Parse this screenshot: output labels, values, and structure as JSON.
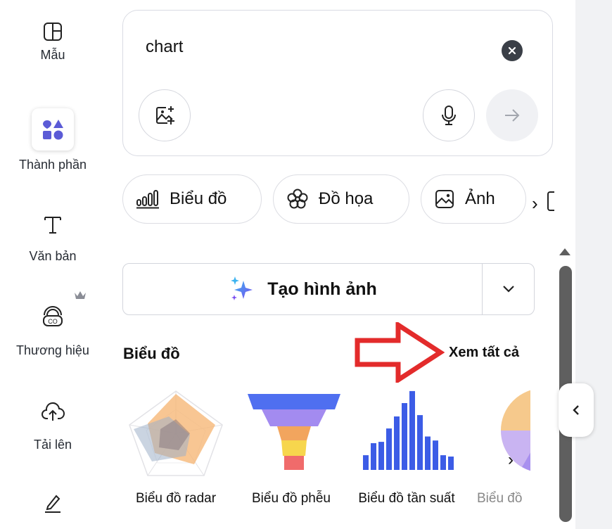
{
  "nav": {
    "items": [
      {
        "label": "Mẫu",
        "icon": "template-icon"
      },
      {
        "label": "Thành phần",
        "icon": "elements-icon",
        "active": true
      },
      {
        "label": "Văn bản",
        "icon": "text-icon"
      },
      {
        "label": "Thương hiệu",
        "icon": "brand-icon",
        "badge": "crown-icon"
      },
      {
        "label": "Tải lên",
        "icon": "upload-cloud-icon"
      },
      {
        "label": "",
        "icon": "draw-icon"
      }
    ]
  },
  "search": {
    "query": "chart",
    "buttons": [
      "image-upload-icon",
      "microphone-icon",
      "send-arrow-icon"
    ]
  },
  "chips": [
    {
      "label": "Biểu đồ",
      "icon": "bar-chart-icon"
    },
    {
      "label": "Đồ họa",
      "icon": "flower-icon"
    },
    {
      "label": "Ảnh",
      "icon": "photo-icon"
    }
  ],
  "generate": {
    "label": "Tạo hình ảnh",
    "icon": "sparkle-icon"
  },
  "section": {
    "title": "Biểu đồ",
    "see_all": "Xem tất cả"
  },
  "cards": [
    {
      "label": "Biểu đồ radar"
    },
    {
      "label": "Biểu đồ phễu"
    },
    {
      "label": "Biểu đồ tần suất"
    },
    {
      "label": "Biểu đồ"
    }
  ],
  "colors": {
    "accent": "#5b5bd6",
    "funnel": [
      "#4f6ff0",
      "#a38bf0",
      "#f2a55e",
      "#f7d64d",
      "#f06b6b"
    ],
    "histogram": "#3c5ce6",
    "annotation_arrow": "#e32b2b",
    "right_strip": "#f1f2f4"
  }
}
